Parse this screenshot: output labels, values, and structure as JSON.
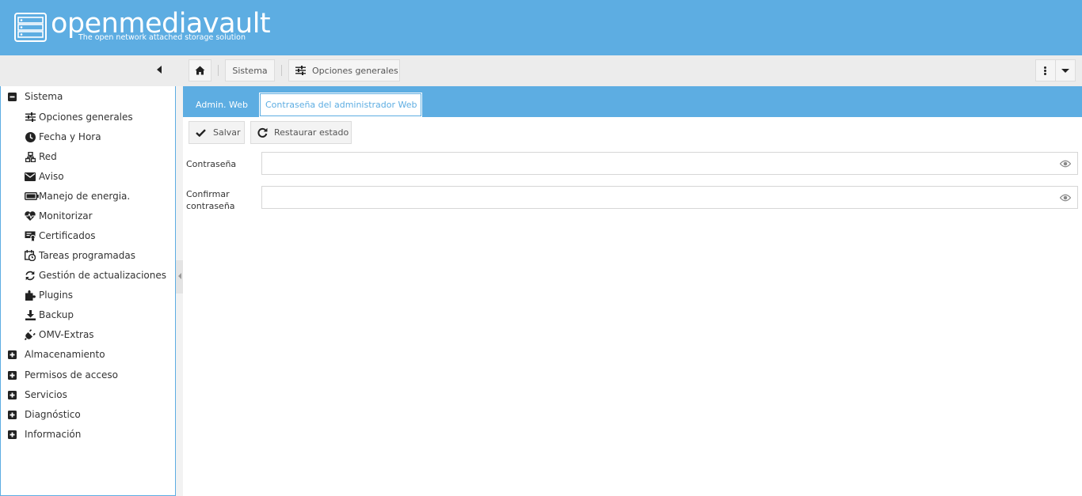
{
  "brand": {
    "name": "openmediavault",
    "tagline": "The open network attached storage solution"
  },
  "breadcrumb": {
    "items": [
      "Sistema",
      "Opciones generales"
    ]
  },
  "sidebar": {
    "items": [
      {
        "label": "Sistema",
        "expanded": true
      },
      {
        "label": "Opciones generales",
        "icon": "sliders-icon"
      },
      {
        "label": "Fecha y Hora",
        "icon": "clock-icon"
      },
      {
        "label": "Red",
        "icon": "network-icon"
      },
      {
        "label": "Aviso",
        "icon": "envelope-icon"
      },
      {
        "label": "Manejo de energia.",
        "icon": "battery-icon"
      },
      {
        "label": "Monitorizar",
        "icon": "heartbeat-icon"
      },
      {
        "label": "Certificados",
        "icon": "certificate-icon"
      },
      {
        "label": "Tareas programadas",
        "icon": "calendar-clock-icon"
      },
      {
        "label": "Gestión de actualizaciones",
        "icon": "refresh-icon"
      },
      {
        "label": "Plugins",
        "icon": "puzzle-icon"
      },
      {
        "label": "Backup",
        "icon": "download-icon"
      },
      {
        "label": "OMV-Extras",
        "icon": "plug-icon"
      },
      {
        "label": "Almacenamiento",
        "expanded": false
      },
      {
        "label": "Permisos de acceso",
        "expanded": false
      },
      {
        "label": "Servicios",
        "expanded": false
      },
      {
        "label": "Diagnóstico",
        "expanded": false
      },
      {
        "label": "Información",
        "expanded": false
      }
    ]
  },
  "tabs": [
    {
      "label": "Admin. Web",
      "active": false
    },
    {
      "label": "Contraseña del administrador Web",
      "active": true
    }
  ],
  "actions": {
    "save_label": "Salvar",
    "reset_label": "Restaurar estado"
  },
  "form": {
    "password_label": "Contraseña",
    "confirm_label_line1": "Confirmar",
    "confirm_label_line2": "contraseña",
    "password_value": "",
    "confirm_value": ""
  },
  "colors": {
    "accent": "#5dade2",
    "toolbar_bg": "#ececec"
  }
}
